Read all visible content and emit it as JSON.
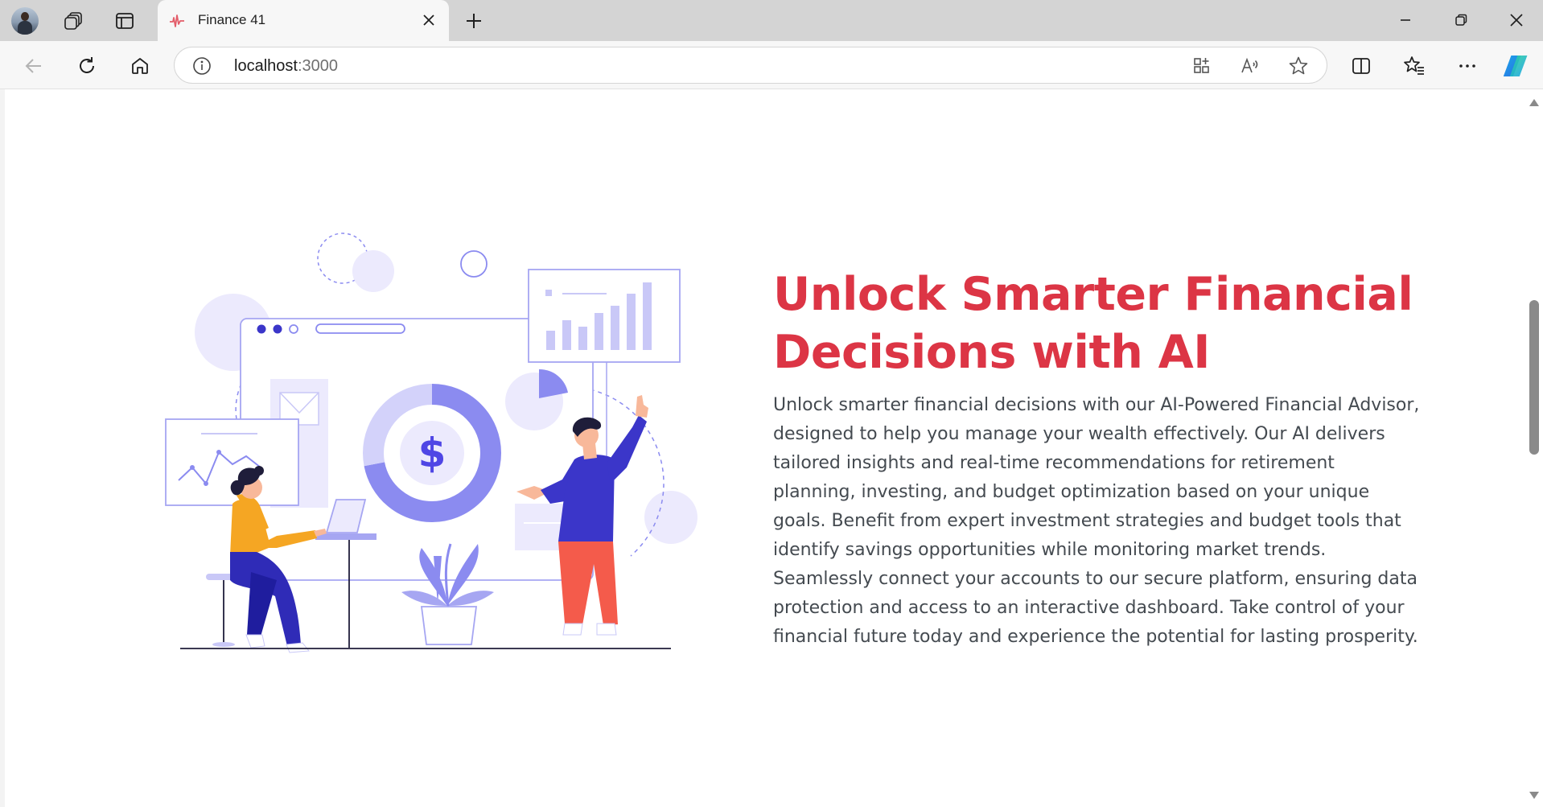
{
  "browser": {
    "tab": {
      "title": "Finance 41"
    },
    "address": {
      "host": "localhost",
      "port": ":3000"
    },
    "icons": {
      "profile": "profile-avatar",
      "workspaces": "workspaces-icon",
      "tab_actions": "vertical-tabs-icon",
      "back": "arrow-left-icon",
      "refresh": "refresh-icon",
      "home": "home-icon",
      "site_info": "info-icon",
      "app_available": "apps-icon",
      "read_aloud": "read-aloud-icon",
      "favorite": "star-icon",
      "split_screen": "split-screen-icon",
      "favorites": "favorites-icon",
      "more": "more-icon",
      "copilot": "copilot-icon"
    }
  },
  "hero": {
    "title": "Unlock Smarter Financial Decisions with AI",
    "description": "Unlock smarter financial decisions with our AI-Powered Financial Advisor, designed to help you manage your wealth effectively. Our AI delivers tailored insights and real-time recommendations for retirement planning, investing, and budget optimization based on your unique goals. Benefit from expert investment strategies and budget tools that identify savings opportunities while monitoring market trends. Seamlessly connect your accounts to our secure platform, ensuring data protection and access to an interactive dashboard. Take control of your financial future today and experience the potential for lasting prosperity.",
    "illustration": {
      "coin_symbol": "$",
      "colors": {
        "primary": "#4f46e5",
        "light": "#e6e6fb",
        "mid": "#8b8bf0",
        "orange": "#f5a623",
        "red": "#f45b4b",
        "dark": "#1f1d3a"
      }
    }
  },
  "colors": {
    "accent": "#dc3545",
    "body_text": "#444a50",
    "tabbar": "#d4d4d4",
    "copilot": "#1aa4e8"
  }
}
